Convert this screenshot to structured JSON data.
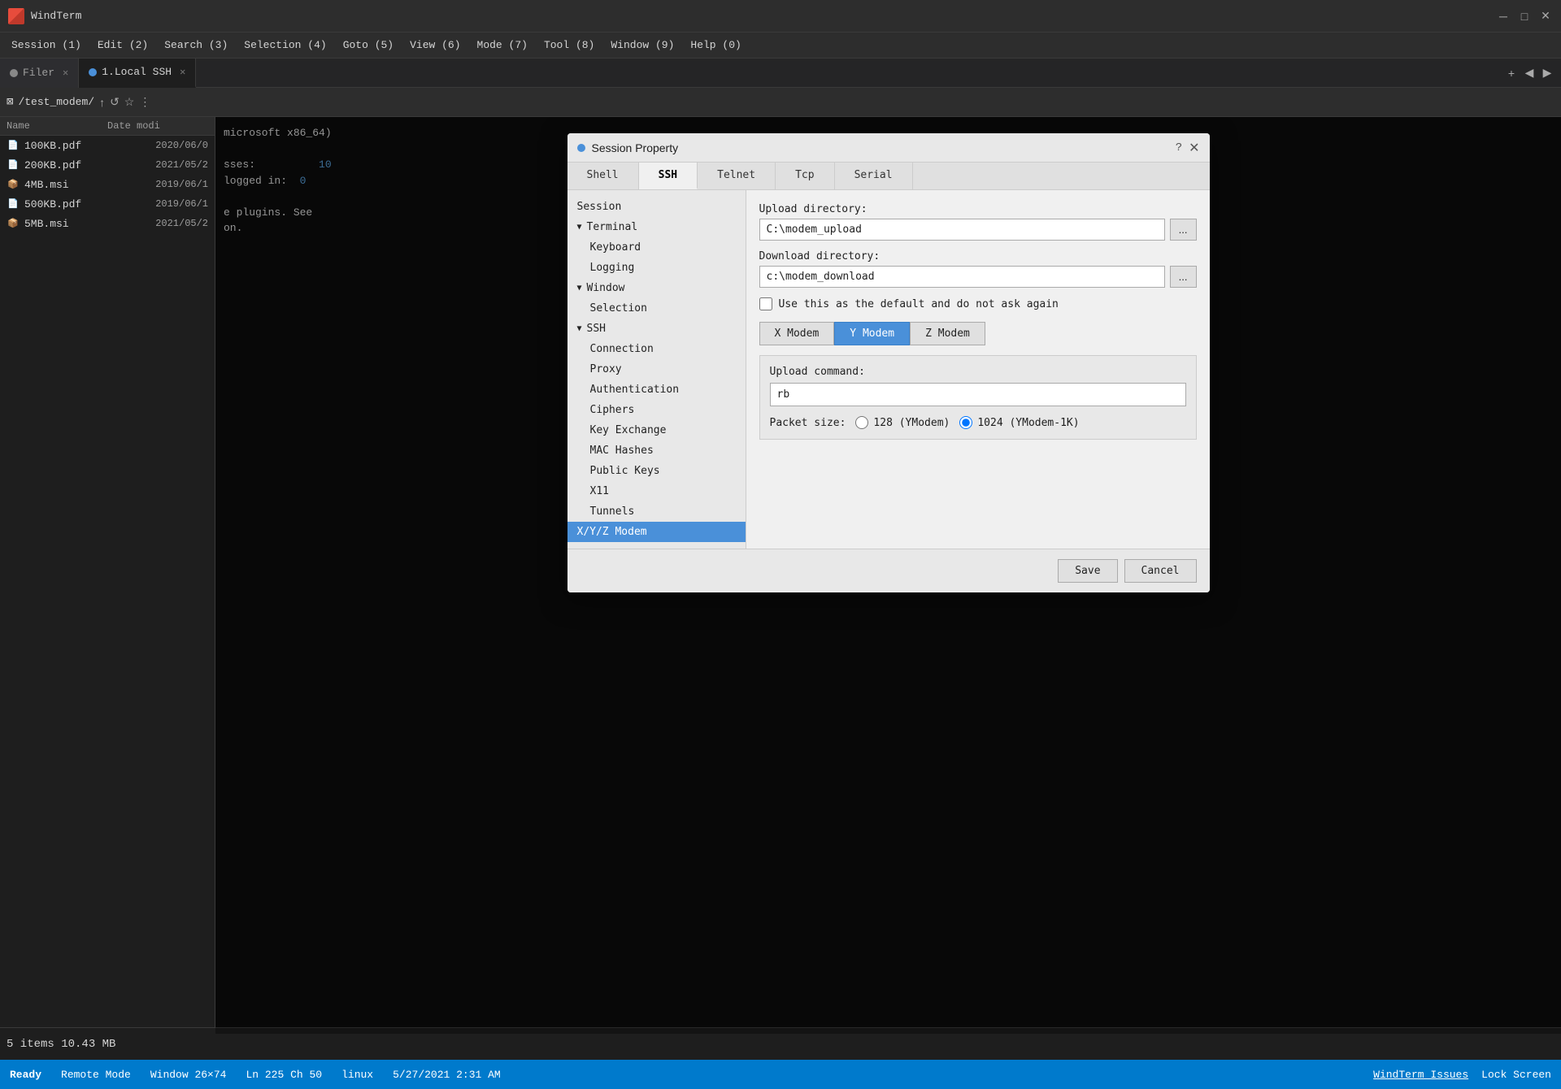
{
  "app": {
    "title": "WindTerm",
    "logo_color": "#e74c3c"
  },
  "title_controls": {
    "minimize": "─",
    "maximize": "□",
    "close": "✕"
  },
  "menu_bar": {
    "items": [
      "Session (1)",
      "Edit (2)",
      "Search (3)",
      "Selection (4)",
      "Goto (5)",
      "View (6)",
      "Mode (7)",
      "Tool (8)",
      "Window (9)",
      "Help (0)"
    ]
  },
  "tabs": [
    {
      "id": "filer",
      "label": "Filer",
      "color": "#888",
      "active": false
    },
    {
      "id": "local-ssh",
      "label": "1.Local SSH",
      "color": "#4a90d9",
      "active": true
    }
  ],
  "tab_add_label": "+",
  "address_bar": {
    "path": "/test_modem/",
    "icon": "⊠"
  },
  "file_panel": {
    "columns": {
      "name": "Name",
      "date": "Date modi"
    },
    "files": [
      {
        "name": "100KB.pdf",
        "date": "2020/06/0",
        "type": "pdf"
      },
      {
        "name": "200KB.pdf",
        "date": "2021/05/2",
        "type": "pdf"
      },
      {
        "name": "4MB.msi",
        "date": "2019/06/1",
        "type": "msi"
      },
      {
        "name": "500KB.pdf",
        "date": "2019/06/1",
        "type": "pdf"
      },
      {
        "name": "5MB.msi",
        "date": "2021/05/2",
        "type": "msi"
      }
    ]
  },
  "terminal": {
    "lines": [
      {
        "text": "microsoft x86_64)",
        "color": "normal"
      },
      {
        "text": "",
        "color": "normal"
      },
      {
        "text": "sses:          10",
        "color": "normal"
      },
      {
        "text": "logged in:  0",
        "color": "normal"
      },
      {
        "text": "",
        "color": "normal"
      },
      {
        "text": "e plugins. See",
        "color": "normal"
      },
      {
        "text": "on.",
        "color": "normal"
      }
    ]
  },
  "dialog": {
    "title": "Session Property",
    "dot_color": "#4a90d9",
    "help_label": "?",
    "close_label": "✕",
    "tabs": [
      {
        "id": "shell",
        "label": "Shell",
        "active": false
      },
      {
        "id": "ssh",
        "label": "SSH",
        "active": true
      },
      {
        "id": "telnet",
        "label": "Telnet",
        "active": false
      },
      {
        "id": "tcp",
        "label": "Tcp",
        "active": false
      },
      {
        "id": "serial",
        "label": "Serial",
        "active": false
      }
    ],
    "nav_tree": {
      "items": [
        {
          "id": "session",
          "label": "Session",
          "level": 0,
          "expanded": false,
          "active": false
        },
        {
          "id": "terminal",
          "label": "Terminal",
          "level": 0,
          "expanded": true,
          "active": false,
          "arrow": "▼"
        },
        {
          "id": "keyboard",
          "label": "Keyboard",
          "level": 1,
          "active": false
        },
        {
          "id": "logging",
          "label": "Logging",
          "level": 1,
          "active": false
        },
        {
          "id": "window",
          "label": "Window",
          "level": 0,
          "expanded": true,
          "active": false,
          "arrow": "▼"
        },
        {
          "id": "selection",
          "label": "Selection",
          "level": 1,
          "active": false
        },
        {
          "id": "ssh",
          "label": "SSH",
          "level": 0,
          "expanded": true,
          "active": false,
          "arrow": "▼"
        },
        {
          "id": "connection",
          "label": "Connection",
          "level": 1,
          "active": false
        },
        {
          "id": "proxy",
          "label": "Proxy",
          "level": 1,
          "active": false
        },
        {
          "id": "authentication",
          "label": "Authentication",
          "level": 1,
          "active": false
        },
        {
          "id": "ciphers",
          "label": "Ciphers",
          "level": 1,
          "active": false
        },
        {
          "id": "key-exchange",
          "label": "Key Exchange",
          "level": 1,
          "active": false
        },
        {
          "id": "mac-hashes",
          "label": "MAC Hashes",
          "level": 1,
          "active": false
        },
        {
          "id": "public-keys",
          "label": "Public Keys",
          "level": 1,
          "active": false
        },
        {
          "id": "x11",
          "label": "X11",
          "level": 1,
          "active": false
        },
        {
          "id": "tunnels",
          "label": "Tunnels",
          "level": 1,
          "active": false
        },
        {
          "id": "xyz-modem",
          "label": "X/Y/Z Modem",
          "level": 0,
          "active": true
        }
      ]
    },
    "content": {
      "upload_dir_label": "Upload directory:",
      "upload_dir_value": "C:\\modem_upload",
      "browse1_label": "...",
      "download_dir_label": "Download directory:",
      "download_dir_value": "c:\\modem_download",
      "browse2_label": "...",
      "checkbox_label": "Use this as the default and do not ask again",
      "checkbox_checked": false,
      "modem_tabs": [
        {
          "id": "x-modem",
          "label": "X Modem",
          "active": false
        },
        {
          "id": "y-modem",
          "label": "Y Modem",
          "active": true
        },
        {
          "id": "z-modem",
          "label": "Z Modem",
          "active": false
        }
      ],
      "upload_cmd_label": "Upload command:",
      "upload_cmd_value": "rb",
      "packet_size_label": "Packet size:",
      "packet_options": [
        {
          "label": "128 (YModem)",
          "value": "128",
          "selected": false
        },
        {
          "label": "1024 (YModem-1K)",
          "value": "1024",
          "selected": true
        }
      ]
    },
    "footer": {
      "save_label": "Save",
      "cancel_label": "Cancel"
    }
  },
  "bottom_panel": {
    "item_count": "5 items 10.43 MB"
  },
  "status_bar": {
    "ready": "Ready",
    "remote_mode": "Remote Mode",
    "window_size": "Window 26×74",
    "cursor_pos": "Ln 225 Ch 50",
    "os": "linux",
    "datetime": "5/27/2021 2:31 AM",
    "issues": "WindTerm Issues",
    "lock_screen": "Lock Screen"
  }
}
